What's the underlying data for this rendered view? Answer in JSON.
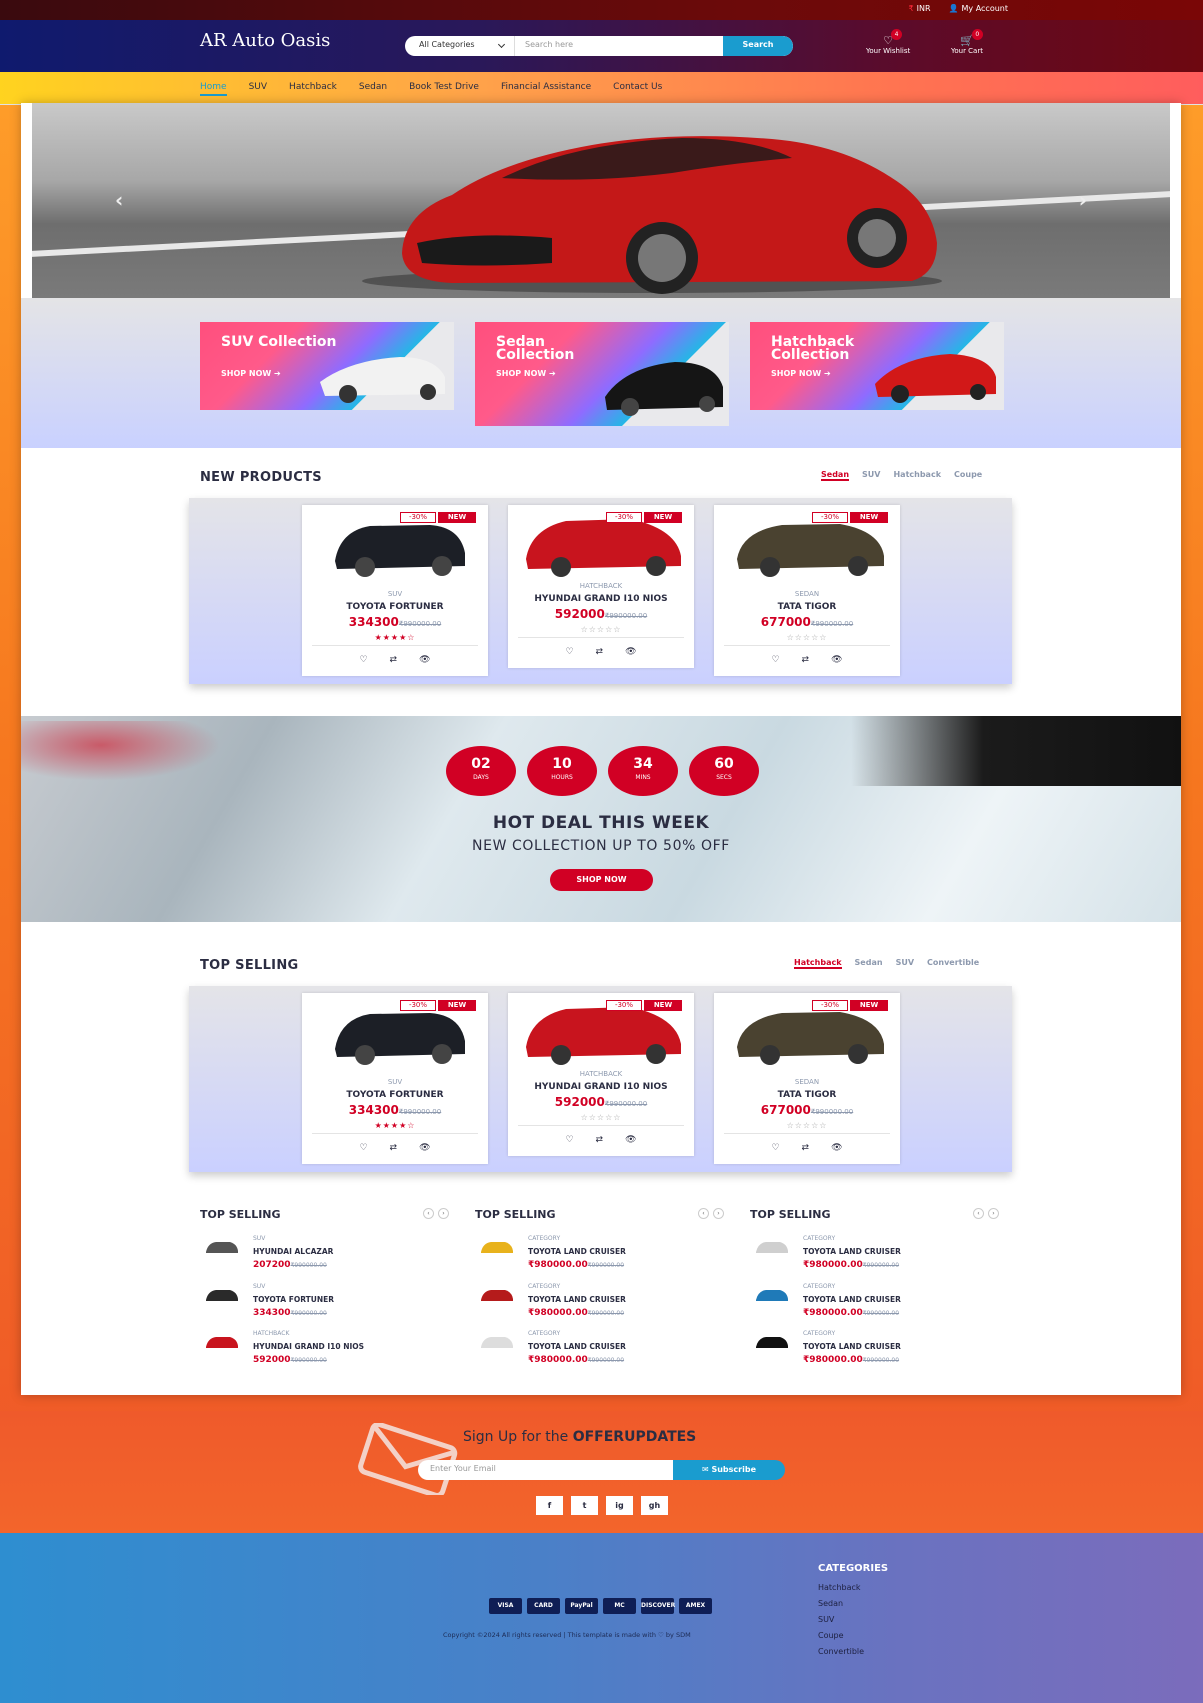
{
  "topbar": {
    "currency": "INR",
    "account": "My Account"
  },
  "header": {
    "logo": "AR Auto Oasis",
    "search_category": "All Categories",
    "search_placeholder": "Search here",
    "search_button": "Search",
    "wishlist_label": "Your Wishlist",
    "wishlist_count": "4",
    "cart_label": "Your Cart",
    "cart_count": "0"
  },
  "nav": {
    "items": [
      "Home",
      "SUV",
      "Hatchback",
      "Sedan",
      "Book Test Drive",
      "Financial Assistance",
      "Contact Us"
    ],
    "active": "Home"
  },
  "collections": [
    {
      "title": "SUV Collection",
      "cta": "SHOP NOW ➔"
    },
    {
      "title": "Sedan Collection",
      "cta": "SHOP NOW ➔"
    },
    {
      "title": "Hatchback Collection",
      "cta": "SHOP NOW ➔"
    }
  ],
  "new_products": {
    "title": "NEW PRODUCTS",
    "tabs": [
      "Sedan",
      "SUV",
      "Hatchback",
      "Coupe"
    ],
    "active_tab": "Sedan",
    "products": [
      {
        "discount": "-30%",
        "badge": "NEW",
        "category": "SUV",
        "name": "TOYOTA FORTUNER",
        "price": "334300",
        "old_price": "₹990000.00",
        "stars": "★★★★☆"
      },
      {
        "discount": "-30%",
        "badge": "NEW",
        "category": "HATCHBACK",
        "name": "HYUNDAI GRAND I10 NIOS",
        "price": "592000",
        "old_price": "₹990000.00",
        "stars": "☆☆☆☆☆"
      },
      {
        "discount": "-30%",
        "badge": "NEW",
        "category": "SEDAN",
        "name": "TATA TIGOR",
        "price": "677000",
        "old_price": "₹990000.00",
        "stars": "☆☆☆☆☆"
      }
    ]
  },
  "deal": {
    "timer": [
      {
        "v": "02",
        "u": "DAYS"
      },
      {
        "v": "10",
        "u": "HOURS"
      },
      {
        "v": "34",
        "u": "MINS"
      },
      {
        "v": "60",
        "u": "SECS"
      }
    ],
    "title": "HOT DEAL THIS WEEK",
    "subtitle": "NEW COLLECTION UP TO 50% OFF",
    "button": "SHOP NOW"
  },
  "top_selling": {
    "title": "TOP SELLING",
    "tabs": [
      "Hatchback",
      "Sedan",
      "SUV",
      "Convertible"
    ],
    "active_tab": "Hatchback",
    "products": [
      {
        "discount": "-30%",
        "badge": "NEW",
        "category": "SUV",
        "name": "TOYOTA FORTUNER",
        "price": "334300",
        "old_price": "₹990000.00",
        "stars": "★★★★☆"
      },
      {
        "discount": "-30%",
        "badge": "NEW",
        "category": "HATCHBACK",
        "name": "HYUNDAI GRAND I10 NIOS",
        "price": "592000",
        "old_price": "₹990000.00",
        "stars": "☆☆☆☆☆"
      },
      {
        "discount": "-30%",
        "badge": "NEW",
        "category": "SEDAN",
        "name": "TATA TIGOR",
        "price": "677000",
        "old_price": "₹990000.00",
        "stars": "☆☆☆☆☆"
      }
    ]
  },
  "mini_lists": [
    {
      "title": "TOP SELLING",
      "items": [
        {
          "category": "SUV",
          "name": "HYUNDAI ALCAZAR",
          "price": "207200",
          "old_price": "₹990000.00",
          "color": "#555555"
        },
        {
          "category": "SUV",
          "name": "TOYOTA FORTUNER",
          "price": "334300",
          "old_price": "₹990000.00",
          "color": "#2a2a2a"
        },
        {
          "category": "HATCHBACK",
          "name": "HYUNDAI GRAND I10 NIOS",
          "price": "592000",
          "old_price": "₹990000.00",
          "color": "#c8141e"
        }
      ]
    },
    {
      "title": "TOP SELLING",
      "items": [
        {
          "category": "CATEGORY",
          "name": "TOYOTA LAND CRUISER",
          "price": "₹980000.00",
          "old_price": "₹990000.00",
          "color": "#e8b21c"
        },
        {
          "category": "CATEGORY",
          "name": "TOYOTA LAND CRUISER",
          "price": "₹980000.00",
          "old_price": "₹990000.00",
          "color": "#b51b1b"
        },
        {
          "category": "CATEGORY",
          "name": "TOYOTA LAND CRUISER",
          "price": "₹980000.00",
          "old_price": "₹990000.00",
          "color": "#dddddd"
        }
      ]
    },
    {
      "title": "TOP SELLING",
      "items": [
        {
          "category": "CATEGORY",
          "name": "TOYOTA LAND CRUISER",
          "price": "₹980000.00",
          "old_price": "₹990000.00",
          "color": "#cfcfcf"
        },
        {
          "category": "CATEGORY",
          "name": "TOYOTA LAND CRUISER",
          "price": "₹980000.00",
          "old_price": "₹990000.00",
          "color": "#1f7ab8"
        },
        {
          "category": "CATEGORY",
          "name": "TOYOTA LAND CRUISER",
          "price": "₹980000.00",
          "old_price": "₹990000.00",
          "color": "#111111"
        }
      ]
    }
  ],
  "newsletter": {
    "title_prefix": "Sign Up for the ",
    "title_bold": "OFFERUPDATES",
    "placeholder": "Enter Your Email",
    "button": "✉ Subscribe",
    "social": [
      "f",
      "t",
      "ig",
      "gh"
    ]
  },
  "footer": {
    "payments": [
      "VISA",
      "CARD",
      "PayPal",
      "MC",
      "DISCOVER",
      "AMEX"
    ],
    "copyright": "Copyright ©2024 All rights reserved | This template is made with ♡ by SDM",
    "categories_title": "CATEGORIES",
    "categories": [
      "Hatchback",
      "Sedan",
      "SUV",
      "Coupe",
      "Convertible"
    ]
  },
  "colors": {
    "accent": "#d10024",
    "blue": "#1a9ccf"
  }
}
